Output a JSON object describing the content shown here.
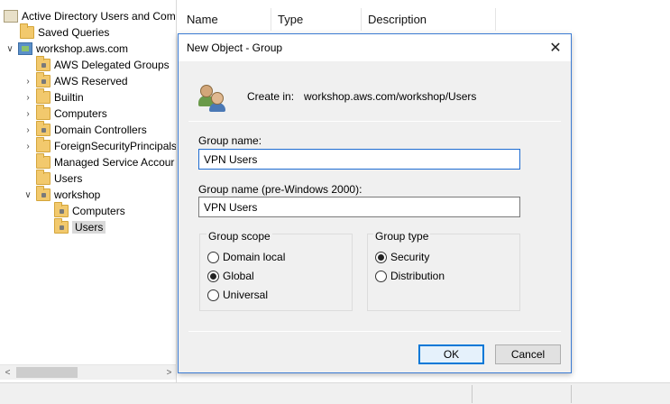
{
  "tree": {
    "items": [
      {
        "label": "Active Directory Users and Com"
      },
      {
        "label": "Saved Queries"
      },
      {
        "label": "workshop.aws.com"
      },
      {
        "label": "AWS Delegated Groups"
      },
      {
        "label": "AWS Reserved"
      },
      {
        "label": "Builtin"
      },
      {
        "label": "Computers"
      },
      {
        "label": "Domain Controllers"
      },
      {
        "label": "ForeignSecurityPrincipals"
      },
      {
        "label": "Managed Service Accour"
      },
      {
        "label": "Users"
      },
      {
        "label": "workshop"
      },
      {
        "label": "Computers"
      },
      {
        "label": "Users"
      }
    ],
    "scroll_left": "<",
    "scroll_right": ">"
  },
  "list": {
    "columns": [
      "Name",
      "Type",
      "Description"
    ]
  },
  "dialog": {
    "title": "New Object - Group",
    "close_glyph": "✕",
    "create_in_label": "Create in:",
    "create_in_path": "workshop.aws.com/workshop/Users",
    "group_name_label": "Group name:",
    "group_name_value": "VPN Users",
    "group_name_pre2000_label": "Group name (pre-Windows 2000):",
    "group_name_pre2000_value": "VPN Users",
    "group_scope": {
      "legend": "Group scope",
      "options": [
        "Domain local",
        "Global",
        "Universal"
      ],
      "selected": "Global"
    },
    "group_type": {
      "legend": "Group type",
      "options": [
        "Security",
        "Distribution"
      ],
      "selected": "Security"
    },
    "ok_label": "OK",
    "cancel_label": "Cancel"
  }
}
